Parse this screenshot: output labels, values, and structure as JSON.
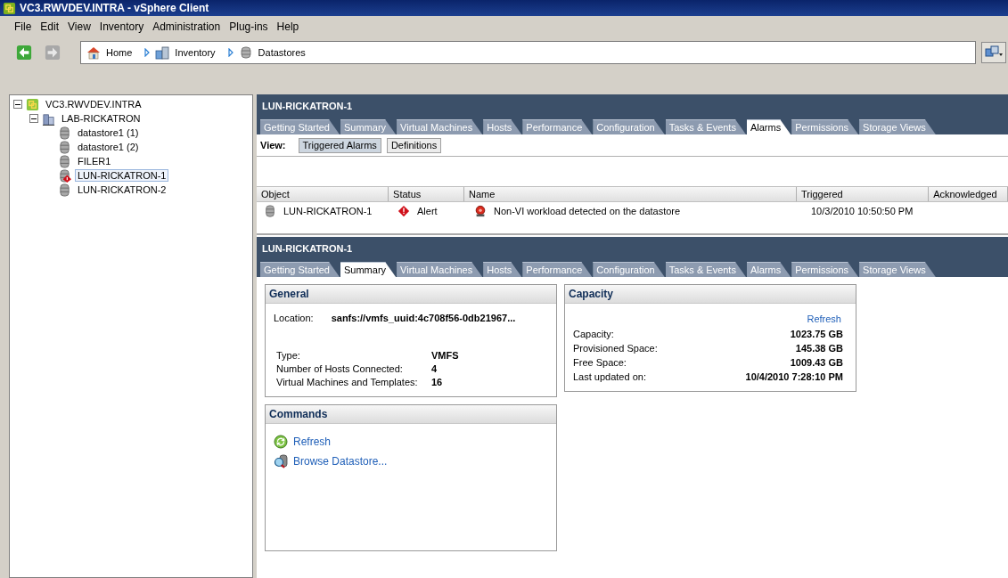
{
  "window": {
    "title": "VC3.RWVDEV.INTRA - vSphere Client"
  },
  "menu": [
    "File",
    "Edit",
    "View",
    "Inventory",
    "Administration",
    "Plug-ins",
    "Help"
  ],
  "breadcrumb": [
    {
      "label": "Home",
      "kind": "home"
    },
    {
      "label": "Inventory",
      "kind": "inventory"
    },
    {
      "label": "Datastores",
      "kind": "datastore"
    }
  ],
  "tree": [
    {
      "label": "VC3.RWVDEV.INTRA",
      "kind": "vcenter",
      "expanded": true,
      "selected": false,
      "children": [
        {
          "label": "LAB-RICKATRON",
          "kind": "datacenter",
          "expanded": true,
          "selected": false,
          "children": [
            {
              "label": "datastore1 (1)",
              "kind": "datastore",
              "selected": false,
              "alert": false
            },
            {
              "label": "datastore1 (2)",
              "kind": "datastore",
              "selected": false,
              "alert": false
            },
            {
              "label": "FILER1",
              "kind": "datastore",
              "selected": false,
              "alert": false
            },
            {
              "label": "LUN-RICKATRON-1",
              "kind": "datastore",
              "selected": true,
              "alert": true
            },
            {
              "label": "LUN-RICKATRON-2",
              "kind": "datastore",
              "selected": false,
              "alert": false
            }
          ]
        }
      ]
    }
  ],
  "alarms_pane": {
    "title": "LUN-RICKATRON-1",
    "tabs": [
      {
        "label": "Getting Started",
        "selected": false
      },
      {
        "label": "Summary",
        "selected": false
      },
      {
        "label": "Virtual Machines",
        "selected": false
      },
      {
        "label": "Hosts",
        "selected": false
      },
      {
        "label": "Performance",
        "selected": false
      },
      {
        "label": "Configuration",
        "selected": false
      },
      {
        "label": "Tasks & Events",
        "selected": false
      },
      {
        "label": "Alarms",
        "selected": true
      },
      {
        "label": "Permissions",
        "selected": false
      },
      {
        "label": "Storage Views",
        "selected": false
      }
    ],
    "view_label": "View:",
    "view_buttons": [
      {
        "label": "Triggered Alarms",
        "selected": true
      },
      {
        "label": "Definitions",
        "selected": false
      }
    ],
    "table": {
      "columns": [
        "Object",
        "Status",
        "Name",
        "Triggered",
        "Acknowledged"
      ],
      "rows": [
        {
          "object": "LUN-RICKATRON-1",
          "status": "Alert",
          "name": "Non-VI workload detected on the datastore",
          "triggered": "10/3/2010 10:50:50 PM"
        }
      ]
    }
  },
  "summary_pane": {
    "title": "LUN-RICKATRON-1",
    "tabs": [
      {
        "label": "Getting Started",
        "selected": false
      },
      {
        "label": "Summary",
        "selected": true
      },
      {
        "label": "Virtual Machines",
        "selected": false
      },
      {
        "label": "Hosts",
        "selected": false
      },
      {
        "label": "Performance",
        "selected": false
      },
      {
        "label": "Configuration",
        "selected": false
      },
      {
        "label": "Tasks & Events",
        "selected": false
      },
      {
        "label": "Alarms",
        "selected": false
      },
      {
        "label": "Permissions",
        "selected": false
      },
      {
        "label": "Storage Views",
        "selected": false
      }
    ],
    "general": {
      "title": "General",
      "location_label": "Location:",
      "location": "sanfs://vmfs_uuid:4c708f56-0db21967...",
      "fields": [
        {
          "label": "Type:",
          "value": "VMFS"
        },
        {
          "label": "Number of Hosts Connected:",
          "value": "4"
        },
        {
          "label": "Virtual Machines and Templates:",
          "value": "16"
        }
      ]
    },
    "capacity": {
      "title": "Capacity",
      "refresh": "Refresh",
      "fields": [
        {
          "label": "Capacity:",
          "value": "1023.75 GB"
        },
        {
          "label": "Provisioned Space:",
          "value": "145.38 GB"
        },
        {
          "label": "Free Space:",
          "value": "1009.43 GB"
        },
        {
          "label": "Last updated on:",
          "value": "10/4/2010 7:28:10 PM"
        }
      ]
    },
    "commands": {
      "title": "Commands",
      "items": [
        {
          "label": "Refresh",
          "kind": "refresh"
        },
        {
          "label": "Browse Datastore...",
          "kind": "browse"
        }
      ]
    }
  }
}
